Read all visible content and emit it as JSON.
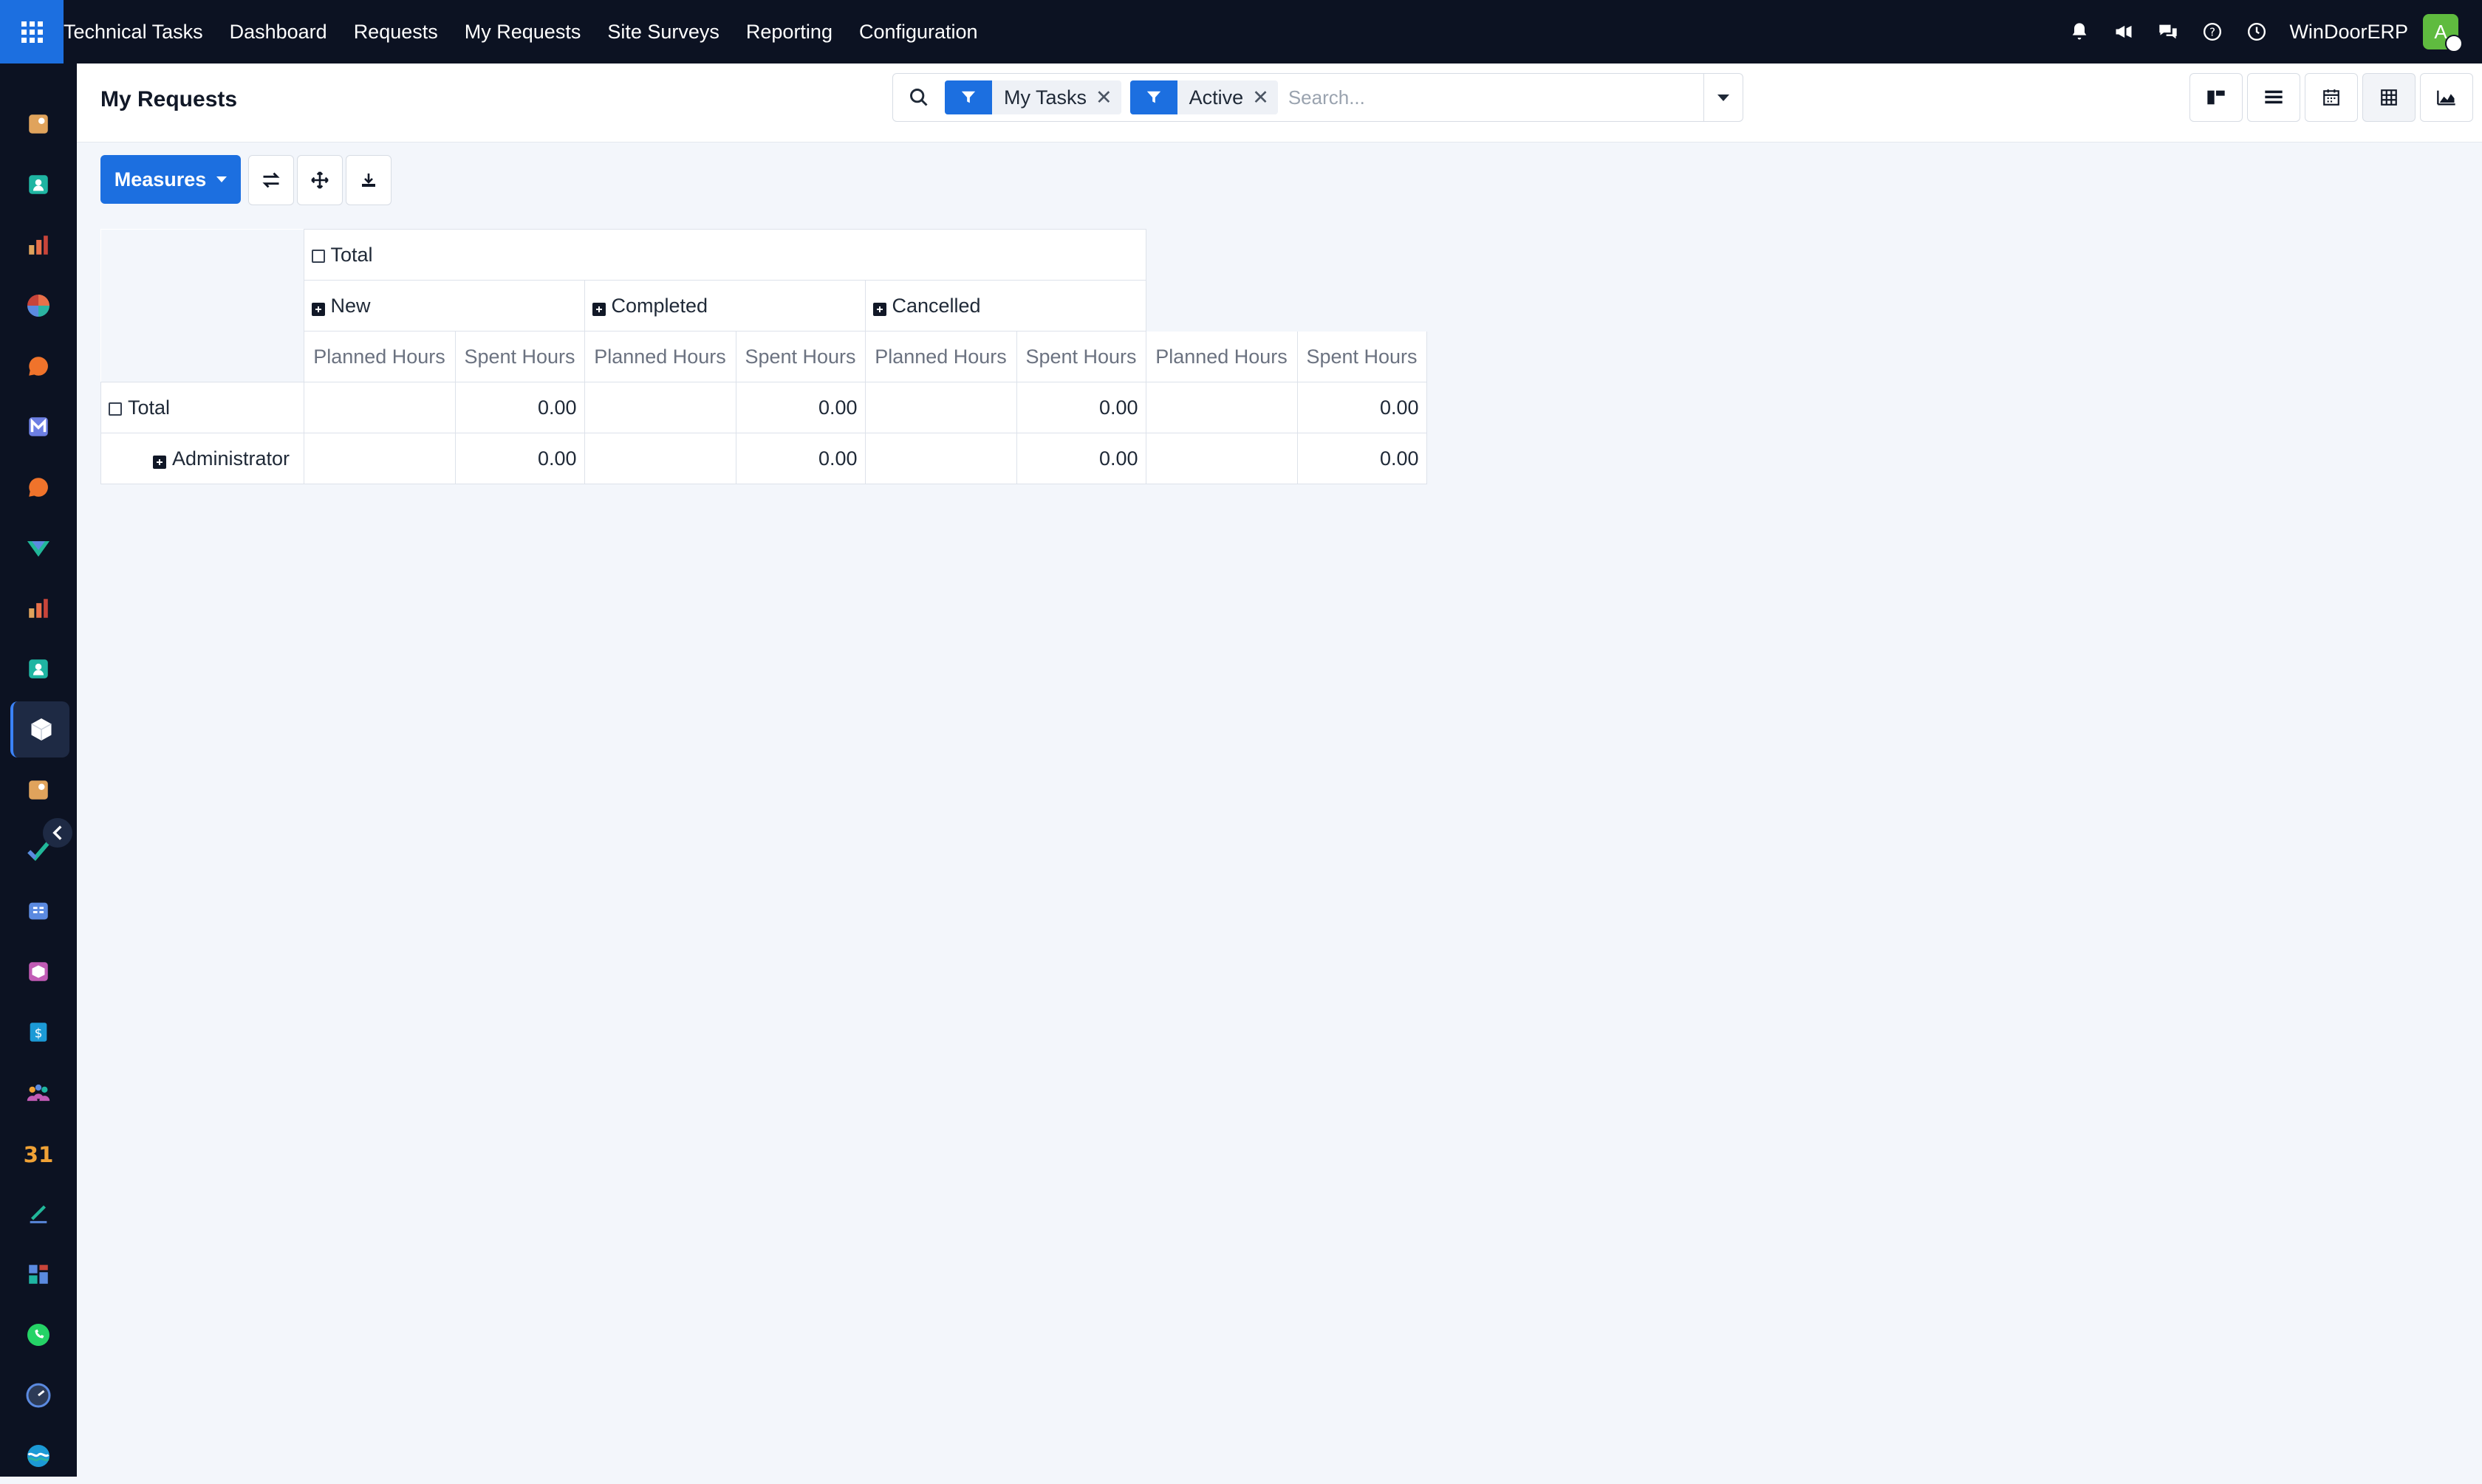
{
  "navbar": {
    "app_name": "Technical Tasks",
    "menu": [
      "Dashboard",
      "Requests",
      "My Requests",
      "Site Surveys",
      "Reporting",
      "Configuration"
    ],
    "company": "WinDoorERP",
    "avatar_initial": "A",
    "icons": [
      "bell-icon",
      "megaphone-icon",
      "chat-icon",
      "help-icon",
      "clock-icon"
    ]
  },
  "sidebar": {
    "apps": [
      {
        "icon": "app-1-icon",
        "color": "#e0a35c"
      },
      {
        "icon": "contacts-icon",
        "color": "#1fb5a2"
      },
      {
        "icon": "sales-icon",
        "color": "#e8704a"
      },
      {
        "icon": "dashboard-icon",
        "color": "#2bb3a1"
      },
      {
        "icon": "chat-bubble-icon",
        "color": "#f0732b"
      },
      {
        "icon": "mail-icon",
        "color": "#6d7fe3"
      },
      {
        "icon": "discuss-icon",
        "color": "#f0732b"
      },
      {
        "icon": "checkmark-icon",
        "color": "#21b799"
      },
      {
        "icon": "reporting-icon",
        "color": "#e8704a"
      },
      {
        "icon": "employees-icon",
        "color": "#1fb5a2"
      },
      {
        "icon": "box-icon",
        "color": "#ffffff",
        "active": true
      },
      {
        "icon": "app-12-icon",
        "color": "#e0a35c"
      },
      {
        "icon": "project-icon",
        "color": "#21b799"
      },
      {
        "icon": "knowledge-icon",
        "color": "#5b8ae0"
      },
      {
        "icon": "inventory-icon",
        "color": "#c15bb5"
      },
      {
        "icon": "invoice-icon",
        "color": "#1c9ad6"
      },
      {
        "icon": "team-icon",
        "color": "#f0a236"
      },
      {
        "icon": "calendar-icon",
        "color": "#f0a236"
      },
      {
        "icon": "sign-icon",
        "color": "#21b799"
      },
      {
        "icon": "apps-icon",
        "color": "#5b8ae0"
      },
      {
        "icon": "whatsapp-icon",
        "color": "#25d366"
      },
      {
        "icon": "clock-app-icon",
        "color": "#5b8ae0"
      },
      {
        "icon": "wave-icon",
        "color": "#1c9ad6"
      }
    ]
  },
  "control_panel": {
    "title": "My Requests",
    "facets": [
      "My Tasks",
      "Active"
    ],
    "search_placeholder": "Search...",
    "views": [
      "kanban-view-icon",
      "list-view-icon",
      "calendar-view-icon",
      "pivot-view-icon",
      "graph-view-icon"
    ]
  },
  "actions": {
    "measures_label": "Measures"
  },
  "pivot": {
    "col_total": "Total",
    "col_groups": [
      "New",
      "Completed",
      "Cancelled"
    ],
    "measures": [
      "Planned Hours",
      "Spent Hours"
    ],
    "rows": [
      {
        "label": "Total",
        "expanded": true,
        "values": [
          "",
          "0.00",
          "",
          "0.00",
          "",
          "0.00",
          "",
          "0.00"
        ]
      },
      {
        "label": "Administrator",
        "expanded": false,
        "values": [
          "",
          "0.00",
          "",
          "0.00",
          "",
          "0.00",
          "",
          "0.00"
        ]
      }
    ]
  }
}
